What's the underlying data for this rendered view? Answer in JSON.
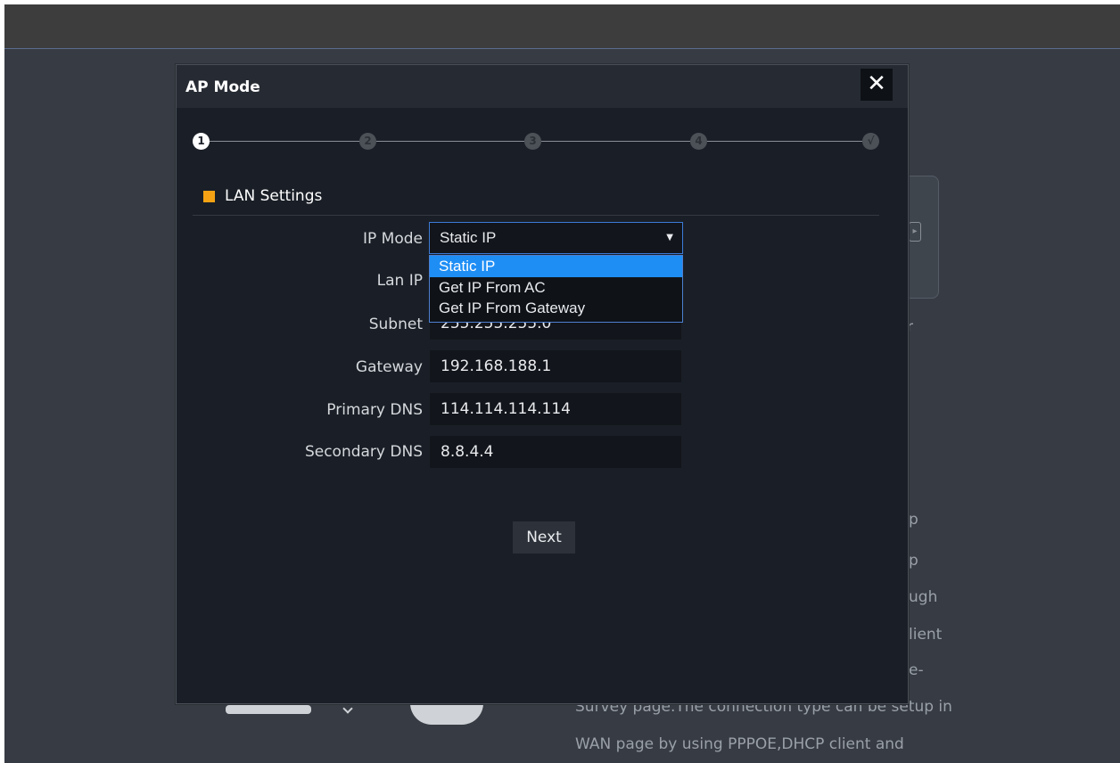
{
  "background": {
    "text_lines": [
      "p",
      "p",
      "ugh",
      "lient",
      "e-",
      "Survey page.The connection type can be setup in",
      "WAN page by using PPPOE,DHCP client and"
    ]
  },
  "modal": {
    "title": "AP Mode",
    "close_symbol": "✕"
  },
  "stepper": {
    "steps": [
      "1",
      "2",
      "3",
      "4",
      "√"
    ],
    "active_index": 0
  },
  "section": {
    "title": "LAN Settings",
    "accent_color": "#f5a314"
  },
  "form": {
    "ip_mode": {
      "label": "IP Mode",
      "value": "Static IP"
    },
    "lan_ip": {
      "label": "Lan IP"
    },
    "subnet": {
      "label": "Subnet",
      "value": "255.255.255.0"
    },
    "gateway": {
      "label": "Gateway",
      "value": "192.168.188.1"
    },
    "primary_dns": {
      "label": "Primary DNS",
      "value": "114.114.114.114"
    },
    "secondary_dns": {
      "label": "Secondary DNS",
      "value": "8.8.4.4"
    }
  },
  "dropdown": {
    "options": [
      "Static IP",
      "Get IP From AC",
      "Get IP From Gateway"
    ],
    "selected": "Static IP"
  },
  "next_label": "Next"
}
